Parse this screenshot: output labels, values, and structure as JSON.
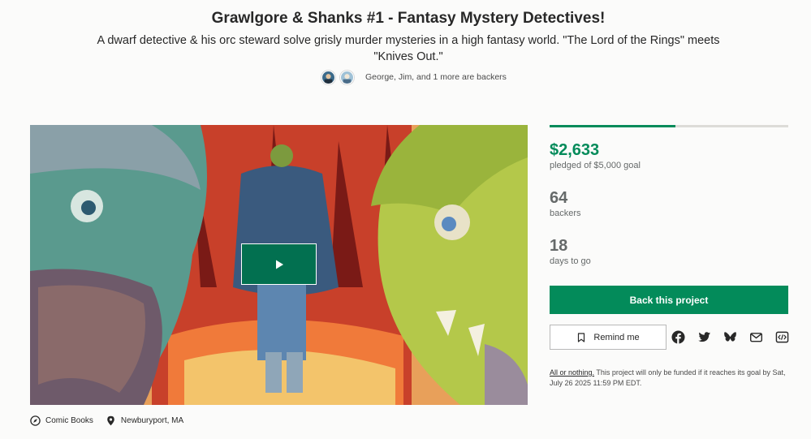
{
  "project": {
    "title": "Grawlgore & Shanks #1 - Fantasy Mystery Detectives!",
    "blurb": "A dwarf detective & his orc steward solve grisly murder mysteries in a high fantasy world. \"The Lord of the Rings\" meets \"Knives Out.\""
  },
  "social": {
    "backers_text": "George, Jim, and 1 more are backers",
    "avatars": [
      "avatar-george",
      "avatar-jim"
    ]
  },
  "media": {
    "play_icon": "play-icon"
  },
  "funding": {
    "progress_fraction": 0.527,
    "pledged": "$2,633",
    "pledged_label": "pledged of $5,000 goal",
    "backers": "64",
    "backers_label": "backers",
    "days": "18",
    "days_label": "days to go"
  },
  "actions": {
    "back_label": "Back this project",
    "remind_label": "Remind me",
    "share_icons": [
      "facebook-icon",
      "twitter-icon",
      "bluesky-icon",
      "email-icon",
      "embed-icon"
    ]
  },
  "all_or_nothing": {
    "link": "All or nothing.",
    "text": " This project will only be funded if it reaches its goal by Sat, July 26 2025 11:59 PM EDT."
  },
  "meta": {
    "category": "Comic Books",
    "location": "Newburyport, MA"
  },
  "colors": {
    "accent": "#038b5a",
    "play_button": "#027050"
  }
}
